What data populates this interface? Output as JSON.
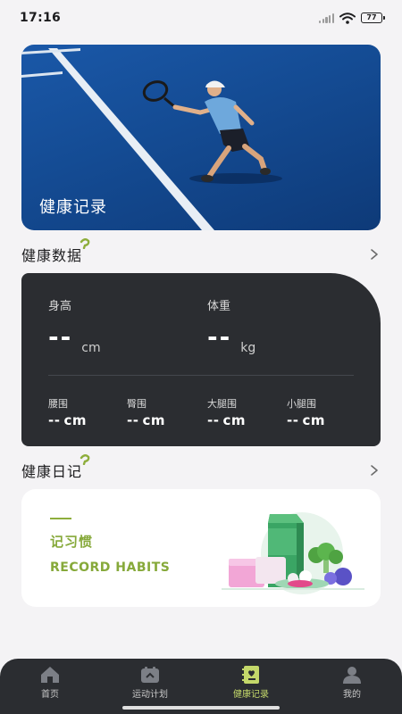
{
  "status_bar": {
    "time": "17:16",
    "battery": "77"
  },
  "hero": {
    "title": "健康记录"
  },
  "health_data": {
    "title": "健康数据",
    "height": {
      "label": "身高",
      "value": "--",
      "unit": "cm"
    },
    "weight": {
      "label": "体重",
      "value": "--",
      "unit": "kg"
    },
    "small_metrics": [
      {
        "label": "腰围",
        "value": "--",
        "unit": "cm"
      },
      {
        "label": "臀围",
        "value": "--",
        "unit": "cm"
      },
      {
        "label": "大腿围",
        "value": "--",
        "unit": "cm"
      },
      {
        "label": "小腿围",
        "value": "--",
        "unit": "cm"
      }
    ]
  },
  "diary": {
    "title": "健康日记",
    "card_title_cn": "记习惯",
    "card_title_en": "RECORD HABITS"
  },
  "tabs": [
    {
      "label": "首页",
      "icon": "home-icon",
      "active": false
    },
    {
      "label": "运动计划",
      "icon": "exercise-plan-icon",
      "active": false
    },
    {
      "label": "健康记录",
      "icon": "health-record-icon",
      "active": true
    },
    {
      "label": "我的",
      "icon": "profile-icon",
      "active": false
    }
  ],
  "colors": {
    "accent": "#86a93a",
    "tab_active": "#c4d86a",
    "dark_card": "#2b2d31",
    "page_bg": "#f4f3f5"
  }
}
